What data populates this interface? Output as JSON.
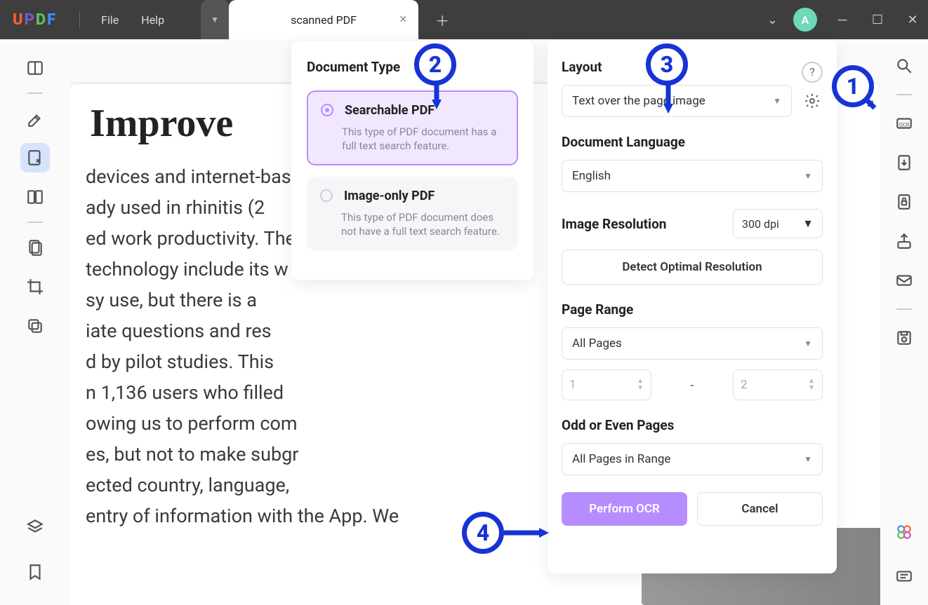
{
  "titlebar": {
    "logo": [
      "U",
      "P",
      "D",
      "F"
    ],
    "menus": [
      "File",
      "Help"
    ],
    "tab_active": "scanned PDF",
    "avatar_letter": "A"
  },
  "left_rail": {
    "tools": [
      "reader",
      "highlighter",
      "edit",
      "compare",
      "page-organize",
      "crop",
      "duplicate"
    ]
  },
  "right_rail": {
    "tools": [
      "search",
      "ocr",
      "convert",
      "protect",
      "share",
      "email",
      "save"
    ]
  },
  "doc": {
    "title": "Improve",
    "body": "devices and internet-bas\nady used in rhinitis (2\ned work productivity. The\ntechnology include its w\nsy use, but there is a\niate questions and res\nd by pilot studies. This\nn 1,136 users who filled\nowing us to perform com\nes, but not to make subgr\nected country, language,\nentry of information with the App. We"
  },
  "ocr": {
    "panel_title": "Document Type",
    "options": [
      {
        "title": "Searchable PDF",
        "desc": "This type of PDF document has a full text search feature.",
        "selected": true
      },
      {
        "title": "Image-only PDF",
        "desc": "This type of PDF document does not have a full text search feature.",
        "selected": false
      }
    ]
  },
  "settings": {
    "layout_label": "Layout",
    "layout_value": "Text over the page image",
    "language_label": "Document Language",
    "language_value": "English",
    "resolution_label": "Image Resolution",
    "resolution_value": "300 dpi",
    "detect_label": "Detect Optimal Resolution",
    "pagerange_label": "Page Range",
    "pagerange_value": "All Pages",
    "range_from": "1",
    "range_to": "2",
    "range_dash": "-",
    "oddeven_label": "Odd or Even Pages",
    "oddeven_value": "All Pages in Range",
    "perform": "Perform OCR",
    "cancel": "Cancel"
  },
  "annotations": {
    "step1": "1",
    "step2": "2",
    "step3": "3",
    "step4": "4"
  }
}
